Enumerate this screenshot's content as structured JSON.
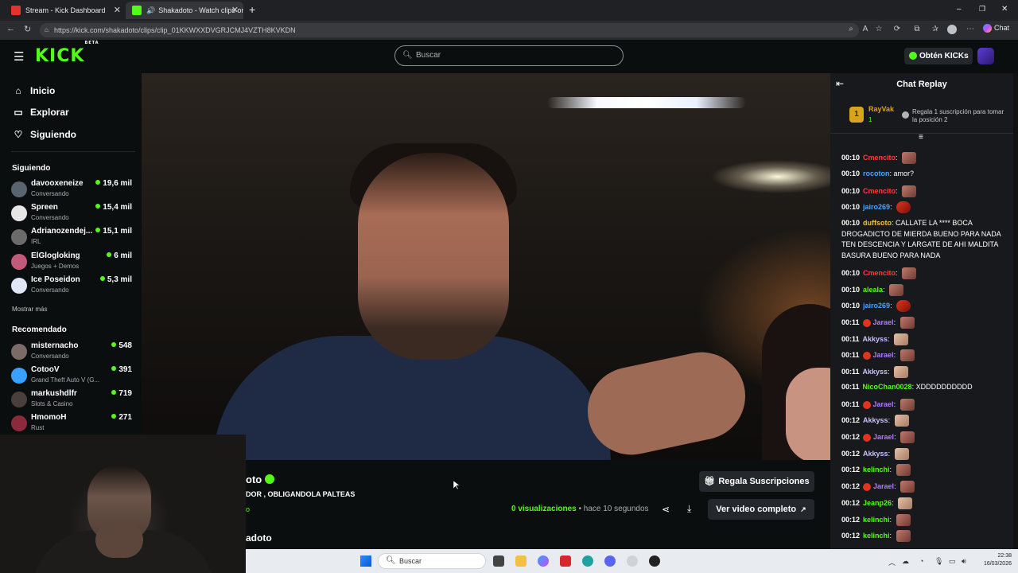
{
  "browser": {
    "tabs": [
      {
        "label": "Stream - Kick Dashboard",
        "active": false
      },
      {
        "label": "Shakadoto - Watch clips on K",
        "active": true
      }
    ],
    "new_tab": "+",
    "url": "https://kick.com/shakadoto/clips/clip_01KKWXXDVGRJCMJ4VZTH8KVKDN",
    "chat_button": "Chat",
    "window_controls": [
      "–",
      "❐",
      "✕"
    ]
  },
  "header": {
    "logo": "KICK",
    "logo_beta": "BETA",
    "search_placeholder": "Buscar",
    "kicks_button": "Obtén KICKs"
  },
  "sidebar": {
    "nav": [
      {
        "label": "Inicio",
        "icon": "home-icon"
      },
      {
        "label": "Explorar",
        "icon": "compass-icon"
      },
      {
        "label": "Siguiendo",
        "icon": "heart-icon"
      }
    ],
    "following_title": "Siguiendo",
    "following": [
      {
        "name": "davooxeneize",
        "category": "Conversando",
        "viewers": "19,6 mil"
      },
      {
        "name": "Spreen",
        "category": "Conversando",
        "viewers": "15,4 mil"
      },
      {
        "name": "Adrianozendej...",
        "category": "IRL",
        "viewers": "15,1 mil"
      },
      {
        "name": "ElGlogloking",
        "category": "Juegos + Demos",
        "viewers": "6 mil"
      },
      {
        "name": "Ice Poseidon",
        "category": "Conversando",
        "viewers": "5,3 mil"
      }
    ],
    "show_more": "Mostrar más",
    "recommended_title": "Recomendado",
    "recommended": [
      {
        "name": "misternacho",
        "category": "Conversando",
        "viewers": "548"
      },
      {
        "name": "CotooV",
        "category": "Grand Theft Auto V (G...",
        "viewers": "391"
      },
      {
        "name": "markushdlfr",
        "category": "Slots & Casino",
        "viewers": "719"
      },
      {
        "name": "HmomoH",
        "category": "Rust",
        "viewers": "271"
      }
    ]
  },
  "clip": {
    "channel_partial": "oto",
    "title_partial": "DOR , OBLIGANDOLA PALTEAS",
    "link_partial": "o",
    "channel_bottom": "adoto",
    "views": "0",
    "views_label": "visualizaciones",
    "time_ago": "• hace 10 segundos",
    "gift_button": "Regala Suscripciones",
    "full_video_button": "Ver video completo"
  },
  "chat": {
    "title": "Chat Replay",
    "pinned": {
      "rank": "1",
      "user": "RayVak",
      "count": "1",
      "gift_text": "Regala 1 suscripción para tomar la posición 2"
    },
    "messages": [
      {
        "ts": "00:10",
        "user": "Cmencito",
        "color": "#ff3b3b",
        "text": "",
        "emote": "normal",
        "badge": false
      },
      {
        "ts": "00:10",
        "user": "rocoton",
        "color": "#4aa3ff",
        "text": "amor?",
        "emote": "",
        "badge": false
      },
      {
        "ts": "00:10",
        "user": "Cmencito",
        "color": "#ff3b3b",
        "text": "",
        "emote": "normal",
        "badge": false
      },
      {
        "ts": "00:10",
        "user": "jairo269",
        "color": "#4aa3ff",
        "text": "",
        "emote": "red",
        "badge": false
      },
      {
        "ts": "00:10",
        "user": "duffsoto",
        "color": "#f0c040",
        "text": "CALLATE LA **** BOCA DROGADICTO DE MIERDA BUENO PARA NADA TEN DESCENCIA Y LARGATE DE AHI MALDITA BASURA BUENO PARA NADA",
        "emote": "",
        "badge": false
      },
      {
        "ts": "00:10",
        "user": "Cmencito",
        "color": "#ff3b3b",
        "text": "",
        "emote": "normal",
        "badge": false
      },
      {
        "ts": "00:10",
        "user": "aleala",
        "color": "#53fc18",
        "text": "",
        "emote": "normal",
        "badge": false
      },
      {
        "ts": "00:10",
        "user": "jairo269",
        "color": "#4aa3ff",
        "text": "",
        "emote": "red",
        "badge": false
      },
      {
        "ts": "00:11",
        "user": "Jarael",
        "color": "#b07cff",
        "text": "",
        "emote": "normal",
        "badge": true
      },
      {
        "ts": "00:11",
        "user": "Akkyss",
        "color": "#c9c2ff",
        "text": "",
        "emote": "pale",
        "badge": false
      },
      {
        "ts": "00:11",
        "user": "Jarael",
        "color": "#b07cff",
        "text": "",
        "emote": "normal",
        "badge": true
      },
      {
        "ts": "00:11",
        "user": "Akkyss",
        "color": "#c9c2ff",
        "text": "",
        "emote": "pale",
        "badge": false
      },
      {
        "ts": "00:11",
        "user": "NicoChan0028",
        "color": "#53fc18",
        "text": "XDDDDDDDDDD",
        "emote": "",
        "badge": false
      },
      {
        "ts": "00:11",
        "user": "Jarael",
        "color": "#b07cff",
        "text": "",
        "emote": "normal",
        "badge": true
      },
      {
        "ts": "00:12",
        "user": "Akkyss",
        "color": "#c9c2ff",
        "text": "",
        "emote": "pale",
        "badge": false
      },
      {
        "ts": "00:12",
        "user": "Jarael",
        "color": "#b07cff",
        "text": "",
        "emote": "normal",
        "badge": true
      },
      {
        "ts": "00:12",
        "user": "Akkyss",
        "color": "#c9c2ff",
        "text": "",
        "emote": "pale",
        "badge": false
      },
      {
        "ts": "00:12",
        "user": "kelinchi",
        "color": "#53fc18",
        "text": "",
        "emote": "normal",
        "badge": false
      },
      {
        "ts": "00:12",
        "user": "Jarael",
        "color": "#b07cff",
        "text": "",
        "emote": "normal",
        "badge": true
      },
      {
        "ts": "00:12",
        "user": "Jeanp26",
        "color": "#53fc18",
        "text": "",
        "emote": "pale",
        "badge": false
      },
      {
        "ts": "00:12",
        "user": "kelinchi",
        "color": "#53fc18",
        "text": "",
        "emote": "normal",
        "badge": false
      },
      {
        "ts": "00:12",
        "user": "kelinchi",
        "color": "#53fc18",
        "text": "",
        "emote": "normal",
        "badge": false
      }
    ]
  },
  "taskbar": {
    "search_placeholder": "Buscar",
    "time": "22:38",
    "date": "16/03/2026"
  },
  "colors": {
    "accent": "#53fc18",
    "background": "#0b0e0f",
    "chat_bg": "#18191c"
  }
}
